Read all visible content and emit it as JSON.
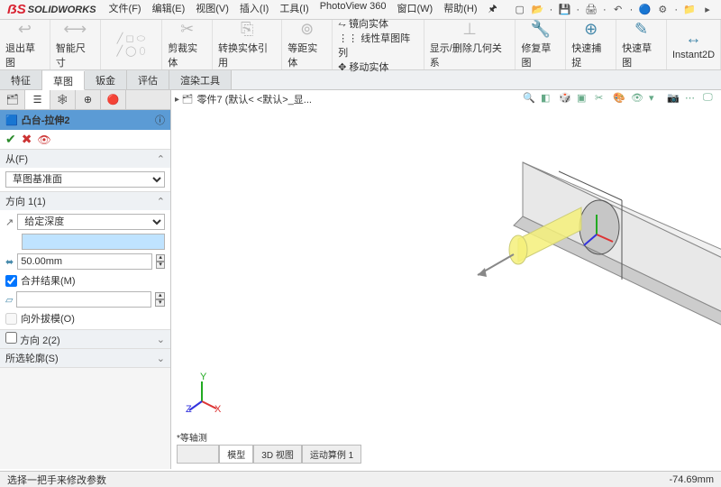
{
  "app": {
    "name": "SOLIDWORKS"
  },
  "menu": {
    "file": "文件(F)",
    "edit": "编辑(E)",
    "view": "视图(V)",
    "insert": "插入(I)",
    "tools": "工具(I)",
    "pv360": "PhotoView 360",
    "window": "窗口(W)",
    "help": "帮助(H)"
  },
  "quick": {
    "search_ph": "★"
  },
  "ribbon": {
    "g1": "退出草图",
    "g2": "智能尺寸",
    "mirror": "镜向实体",
    "linear": "线性草图阵列",
    "move": "移动实体",
    "convert": "转换实体引用",
    "trim": "剪裁实体",
    "offset": "等距实体",
    "display": "显示/删除几何关系",
    "repair": "修复草图",
    "snap": "快速捕捉",
    "sketch": "快速草图",
    "instant": "Instant2D"
  },
  "tabs": {
    "feature": "特征",
    "sketch": "草图",
    "sheet": "钣金",
    "eval": "评估",
    "render": "渲染工具"
  },
  "pm": {
    "title": "凸台-拉伸2",
    "from": "从(F)",
    "from_opt": "草图基准面",
    "dir1": "方向 1(1)",
    "end_opt": "给定深度",
    "depth": "50.00mm",
    "merge": "合并结果(M)",
    "draft_out": "向外拔模(O)",
    "dir2": "方向 2(2)",
    "sel": "所选轮廓(S)"
  },
  "vp": {
    "breadcrumb": "零件7  (默认< <默认>_显...",
    "orient": "*等轴测"
  },
  "btm": {
    "model": "模型",
    "view3d": "3D 视图",
    "motion": "运动算例 1"
  },
  "status": {
    "hint": "选择一把手来修改参数",
    "coord": "-74.69mm"
  }
}
